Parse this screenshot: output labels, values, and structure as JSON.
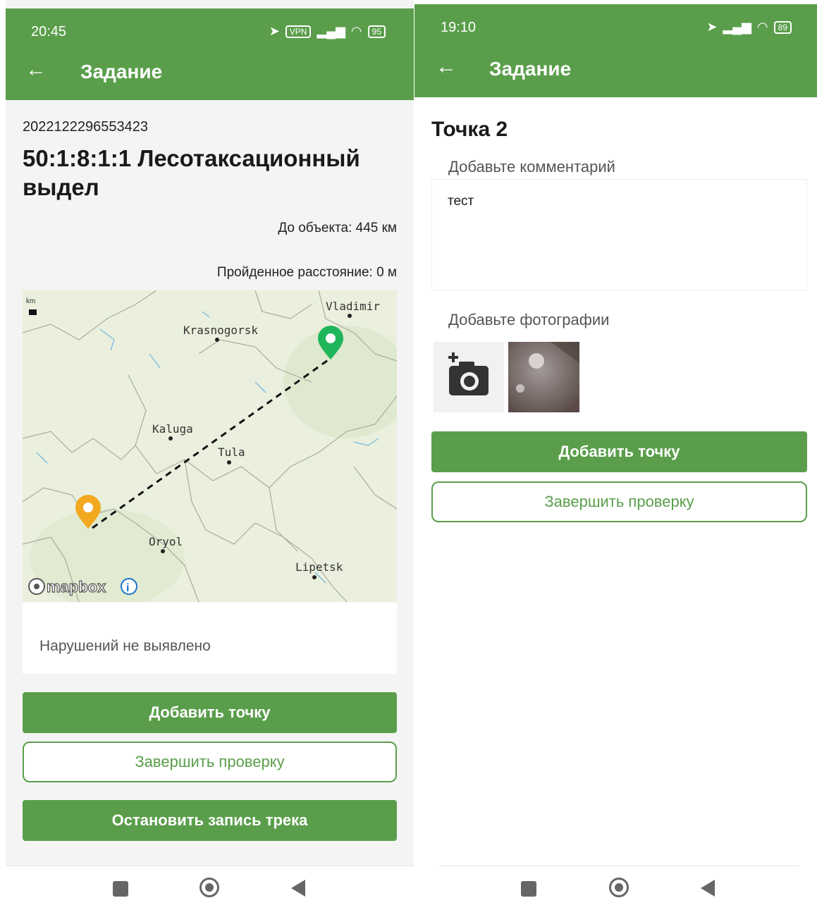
{
  "left": {
    "status": {
      "time": "20:45",
      "vpn": "VPN",
      "battery": "95"
    },
    "appbar": {
      "title": "Задание"
    },
    "task": {
      "id": "2022122296553423",
      "name": "50:1:8:1:1 Лесотаксационный выдел",
      "distance_to_object": "До объекта: 445 км",
      "distance_traveled": "Пройденное расстояние: 0 м"
    },
    "map": {
      "scale_label": "km",
      "cities": [
        "Vladimir",
        "Krasnogorsk",
        "Kaluga",
        "Tula",
        "Oryol",
        "Lipetsk"
      ],
      "attribution": "mapbox",
      "markers": [
        {
          "name": "destination",
          "color": "#1fb55b"
        },
        {
          "name": "current-location",
          "color": "#f2a91f"
        }
      ]
    },
    "notes": "Нарушений не выявлено",
    "buttons": {
      "add_point": "Добавить точку",
      "finish_check": "Завершить проверку",
      "stop_track": "Остановить запись трека"
    }
  },
  "right": {
    "status": {
      "time": "19:10",
      "battery": "89"
    },
    "appbar": {
      "title": "Задание"
    },
    "point": {
      "title": "Точка 2",
      "comment_label": "Добавьте комментарий",
      "comment_value": "тест",
      "photos_label": "Добавьте фотографии"
    },
    "buttons": {
      "add_point": "Добавить точку",
      "finish_check": "Завершить проверку"
    }
  },
  "colors": {
    "brand_green": "#5a9e4b",
    "page_bg": "#f4f4f4"
  }
}
